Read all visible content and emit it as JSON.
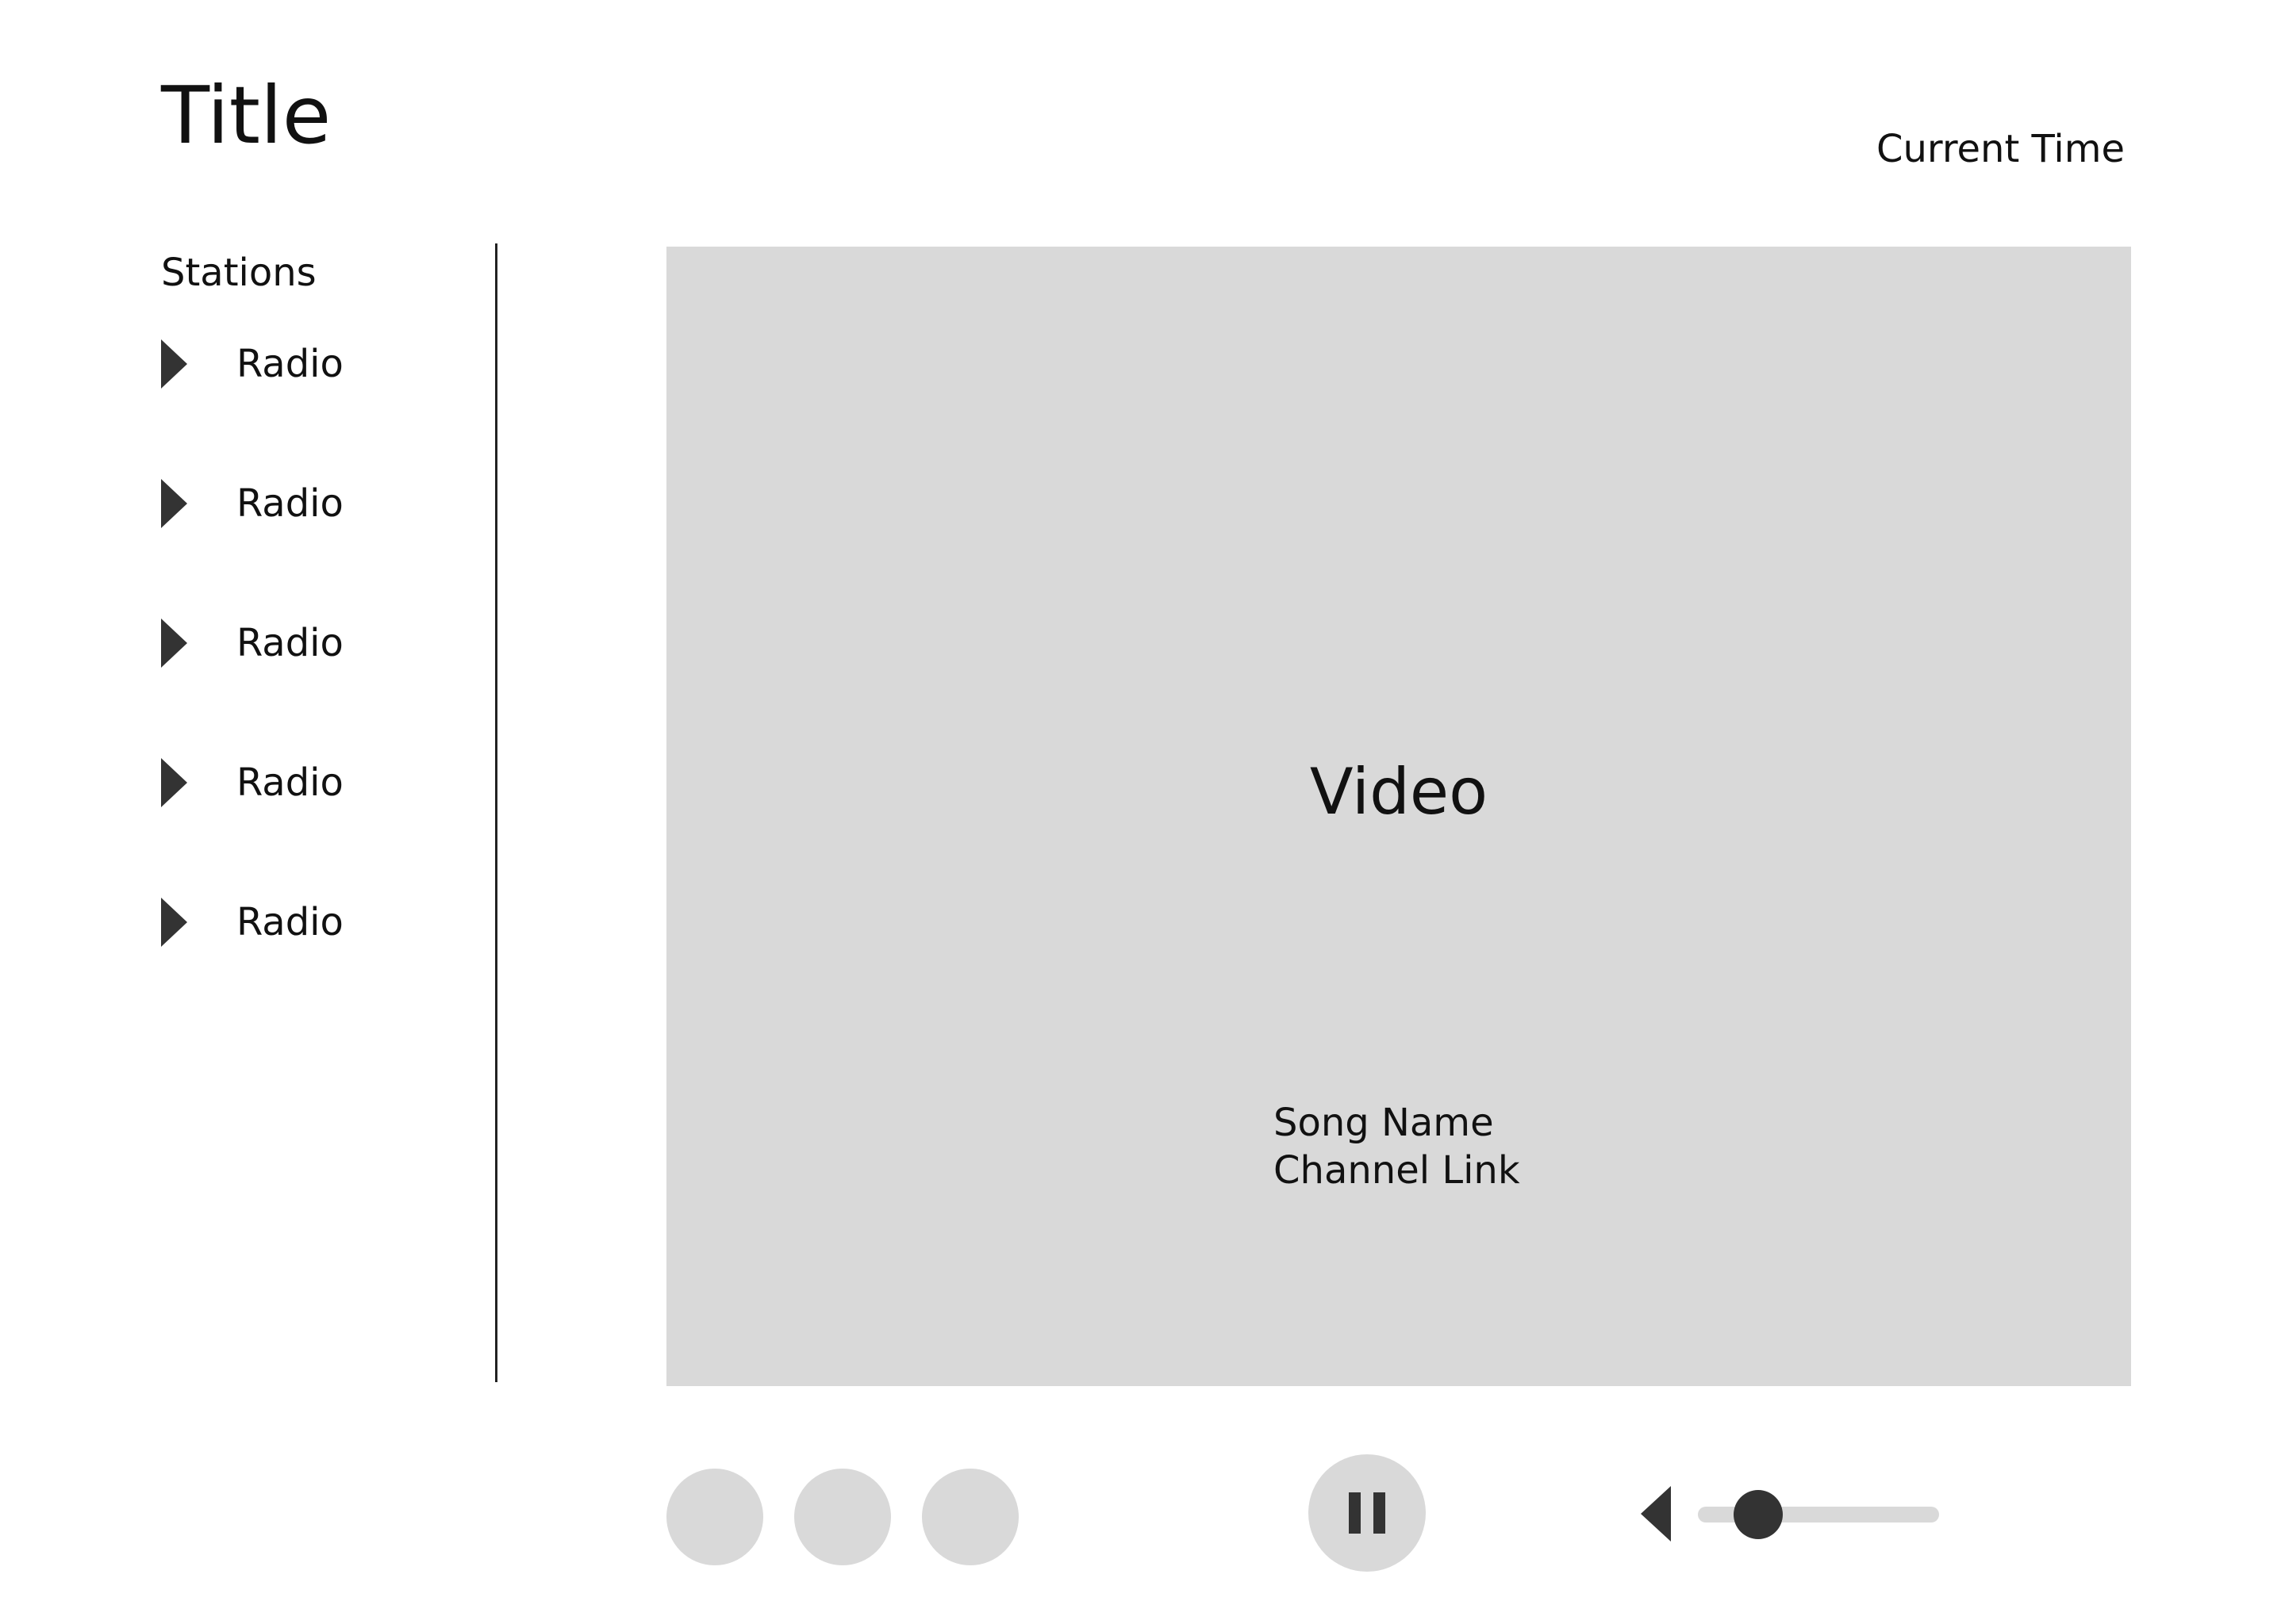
{
  "header": {
    "title": "Title",
    "current_time": "Current Time"
  },
  "sidebar": {
    "heading": "Stations",
    "items": [
      {
        "label": "Radio",
        "icon": "play-arrow-icon"
      },
      {
        "label": "Radio",
        "icon": "play-arrow-icon"
      },
      {
        "label": "Radio",
        "icon": "play-arrow-icon"
      },
      {
        "label": "Radio",
        "icon": "play-arrow-icon"
      },
      {
        "label": "Radio",
        "icon": "play-arrow-icon"
      }
    ]
  },
  "video": {
    "label": "Video",
    "song_name": "Song Name",
    "channel_link": "Channel Link"
  },
  "controls": {
    "buttons": [
      {
        "icon": "circle-button"
      },
      {
        "icon": "circle-button"
      },
      {
        "icon": "circle-button"
      }
    ],
    "play_pause_icon": "pause-icon",
    "volume_icon": "volume-icon",
    "volume_level": 0.25
  },
  "colors": {
    "background": "#ffffff",
    "placeholder": "#d9d9d9",
    "icon": "#333333",
    "text": "#111111"
  }
}
